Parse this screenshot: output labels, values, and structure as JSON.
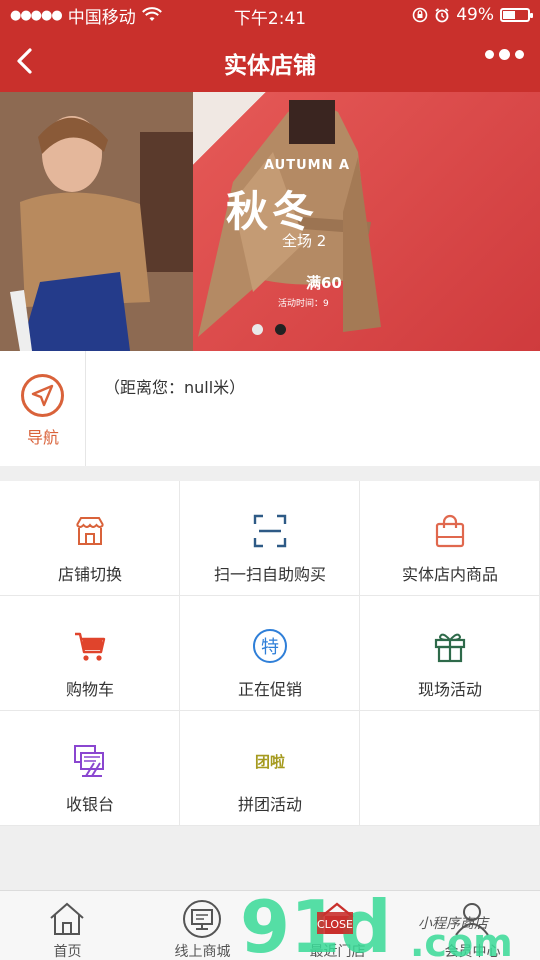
{
  "status_bar": {
    "signal_dots": "●●●●●",
    "carrier": "中国移动",
    "wifi_icon": "wifi-icon",
    "time": "下午2:41",
    "battery_percent": "49%",
    "battery_level": 0.49
  },
  "nav": {
    "title": "实体店铺",
    "back_icon": "chevron-left-icon",
    "more_icon": "more-dots-icon"
  },
  "banner": {
    "en_text": "AUTUMN A",
    "cn_text": "秋冬",
    "sub_text": "全场 2",
    "sub_text2": "满60",
    "time_text": "活动时间：9",
    "pager_total": 2,
    "pager_active": 2
  },
  "store": {
    "nav_label": "导航",
    "distance": "（距离您：null米）"
  },
  "grid": [
    {
      "label": "店铺切换",
      "icon": "storefront-icon",
      "color": "#d9623a"
    },
    {
      "label": "扫一扫自助购买",
      "icon": "scan-icon",
      "color": "#2e5a86"
    },
    {
      "label": "实体店内商品",
      "icon": "shopping-bag-icon",
      "color": "#e0684e"
    },
    {
      "label": "购物车",
      "icon": "cart-icon",
      "color": "#e0442c"
    },
    {
      "label": "正在促销",
      "icon": "special-offer-icon",
      "color": "#2f7fd8"
    },
    {
      "label": "现场活动",
      "icon": "gift-icon",
      "color": "#2e6a4a"
    },
    {
      "label": "收银台",
      "icon": "cashier-icon",
      "color": "#8a46d0"
    },
    {
      "label": "拼团活动",
      "icon": "group-buy-icon",
      "color": "#a59a1e",
      "badge": "团啦"
    }
  ],
  "tabbar": [
    {
      "label": "首页",
      "icon": "home-icon"
    },
    {
      "label": "线上商城",
      "icon": "monitor-icon"
    },
    {
      "label": "最近门店",
      "icon": "store-icon"
    },
    {
      "label": "会员中心",
      "icon": "user-icon"
    }
  ],
  "watermark": {
    "digits": "91",
    "suffix": "d",
    "domain": ".com",
    "small_text": "小程序商店",
    "close_label": "CLOSE"
  }
}
